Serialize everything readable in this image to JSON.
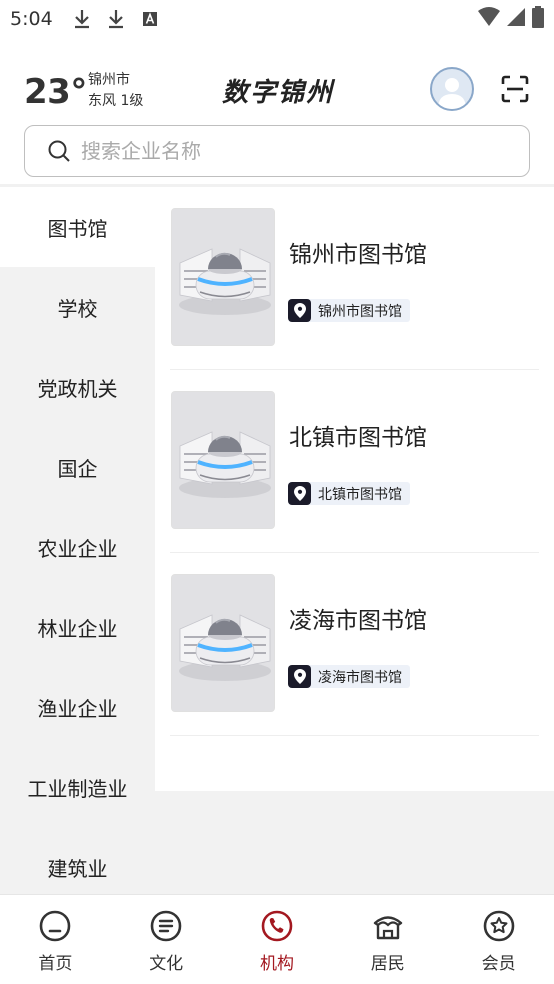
{
  "status_bar": {
    "time": "5:04"
  },
  "header": {
    "temperature": "23°",
    "city": "锦州市",
    "wind": "东风 1级",
    "logo_text": "数字锦州"
  },
  "search": {
    "placeholder": "搜索企业名称"
  },
  "sidebar": {
    "items": [
      {
        "label": "图书馆"
      },
      {
        "label": "学校"
      },
      {
        "label": "党政机关"
      },
      {
        "label": "国企"
      },
      {
        "label": "农业企业"
      },
      {
        "label": "林业企业"
      },
      {
        "label": "渔业企业"
      },
      {
        "label": "工业制造业"
      },
      {
        "label": "建筑业"
      }
    ]
  },
  "list": [
    {
      "title": "锦州市图书馆",
      "tag": "锦州市图书馆"
    },
    {
      "title": "北镇市图书馆",
      "tag": "北镇市图书馆"
    },
    {
      "title": "凌海市图书馆",
      "tag": "凌海市图书馆"
    }
  ],
  "bottom_nav": [
    {
      "label": "首页",
      "icon": "home-icon"
    },
    {
      "label": "文化",
      "icon": "culture-icon"
    },
    {
      "label": "机构",
      "icon": "institution-icon"
    },
    {
      "label": "居民",
      "icon": "resident-icon"
    },
    {
      "label": "会员",
      "icon": "member-icon"
    }
  ],
  "colors": {
    "accent": "#a31820",
    "sidebar_bg": "#f2f2f2",
    "tag_bg": "#edf1f8"
  }
}
